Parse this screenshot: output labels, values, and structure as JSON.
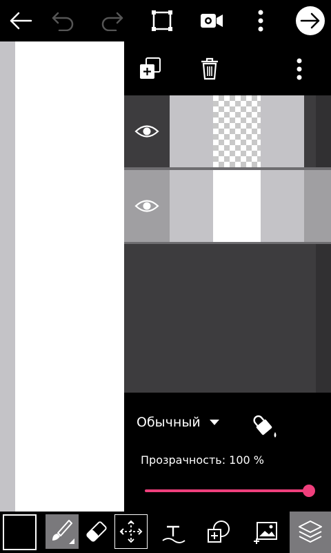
{
  "icons": {
    "back": "arrow-left-icon",
    "undo": "undo-icon",
    "redo": "redo-icon",
    "fullscreen": "fullscreen-icon",
    "video": "video-camera-icon",
    "more": "more-vertical-icon",
    "next": "arrow-right-icon",
    "add_layer": "add-layer-icon",
    "delete_layer": "trash-icon",
    "layer_more": "more-vertical-icon",
    "visibility": "eye-icon",
    "fill": "paint-bucket-icon",
    "brush": "brush-icon",
    "eraser": "eraser-icon",
    "move": "move-icon",
    "text": "text-icon",
    "shape": "shape-select-icon",
    "image": "add-image-icon",
    "layers": "layers-icon"
  },
  "layer_panel": {
    "blend_mode": "Обычный",
    "opacity_label": "Прозрачность: 100 %",
    "opacity_value": 100
  },
  "colors": {
    "slider_accent": "#ef3f7c",
    "current_color": "#000000"
  }
}
